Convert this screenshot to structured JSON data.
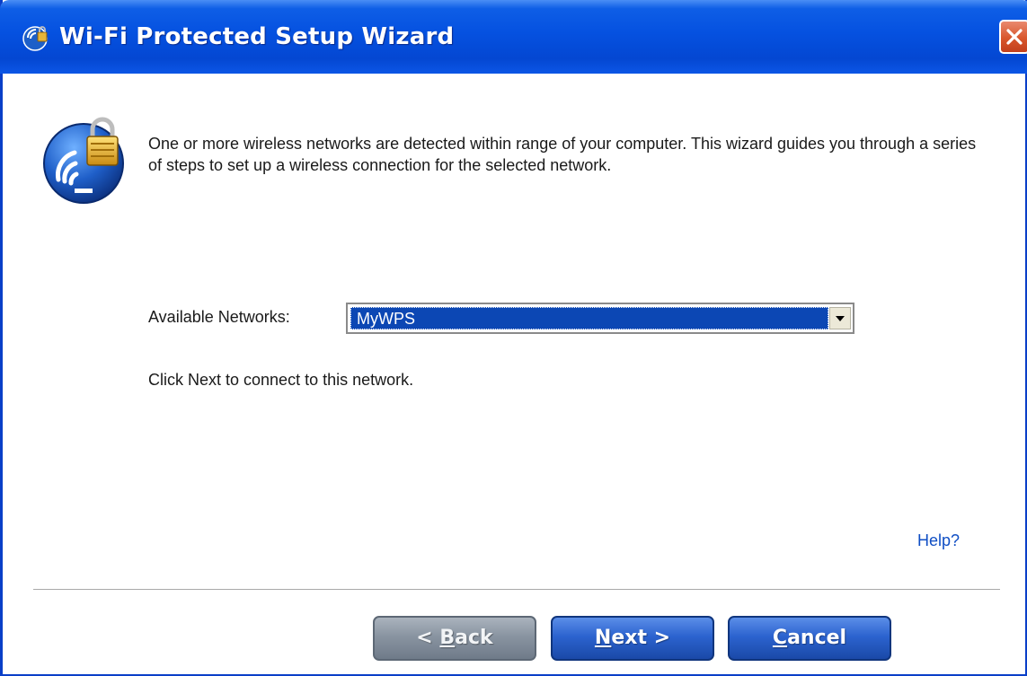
{
  "window": {
    "title": "Wi-Fi Protected Setup Wizard"
  },
  "content": {
    "intro_text": "One or more wireless networks are detected within range of your computer. This wizard guides you through a series of steps to set up a wireless connection for the selected network.",
    "networks_label": "Available Networks:",
    "networks_selected": "MyWPS",
    "hint_text": "Click Next to connect to this network.",
    "help_link": "Help?"
  },
  "buttons": {
    "back_prefix": "< ",
    "back_mnemonic": "B",
    "back_rest": "ack",
    "next_mnemonic": "N",
    "next_rest": "ext >",
    "cancel_mnemonic": "C",
    "cancel_rest": "ancel",
    "back_enabled": false
  },
  "colors": {
    "titlebar": "#0551e0",
    "selection": "#0c47b4",
    "link": "#0f4ec4",
    "close": "#d8562c"
  },
  "icons": {
    "title": "wizard-icon",
    "main": "wifi-lock-icon",
    "close": "close-x-icon",
    "dropdown": "chevron-down-icon"
  }
}
